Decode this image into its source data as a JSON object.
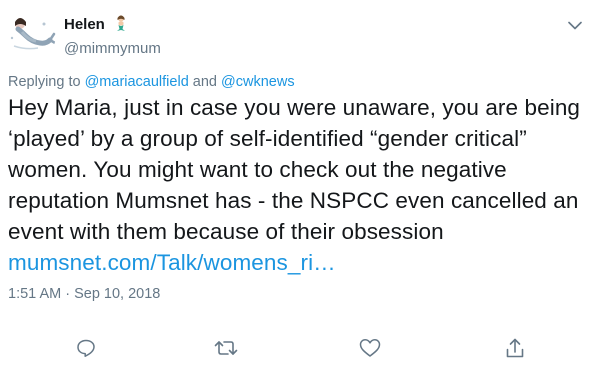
{
  "user": {
    "display_name": "Helen",
    "name_emoji": "mermaid-emoji",
    "handle": "@mimmymum",
    "avatar": "mermaid-avatar-icon"
  },
  "reply_context": {
    "prefix": "Replying to",
    "mention_1": "@mariacaulfield",
    "joiner": "and",
    "mention_2": "@cwknews"
  },
  "tweet": {
    "lines": [
      "Hey Maria, just in case you were unaware, you are being",
      "‘played’ by a group of self-identified “gender critical”",
      "women. You might want to check out the negative",
      "reputation Mumsnet has - the NSPCC even cancelled an",
      "event with them because of their obsession"
    ],
    "link": "mumsnet.com/Talk/womens_ri…",
    "timestamp": "1:51 AM · Sep 10, 2018"
  },
  "actions": [
    "reply-icon",
    "retweet-icon",
    "like-icon",
    "share-icon"
  ],
  "colors": {
    "link": "#1b95e0",
    "secondary": "#657786",
    "text": "#14171a"
  }
}
